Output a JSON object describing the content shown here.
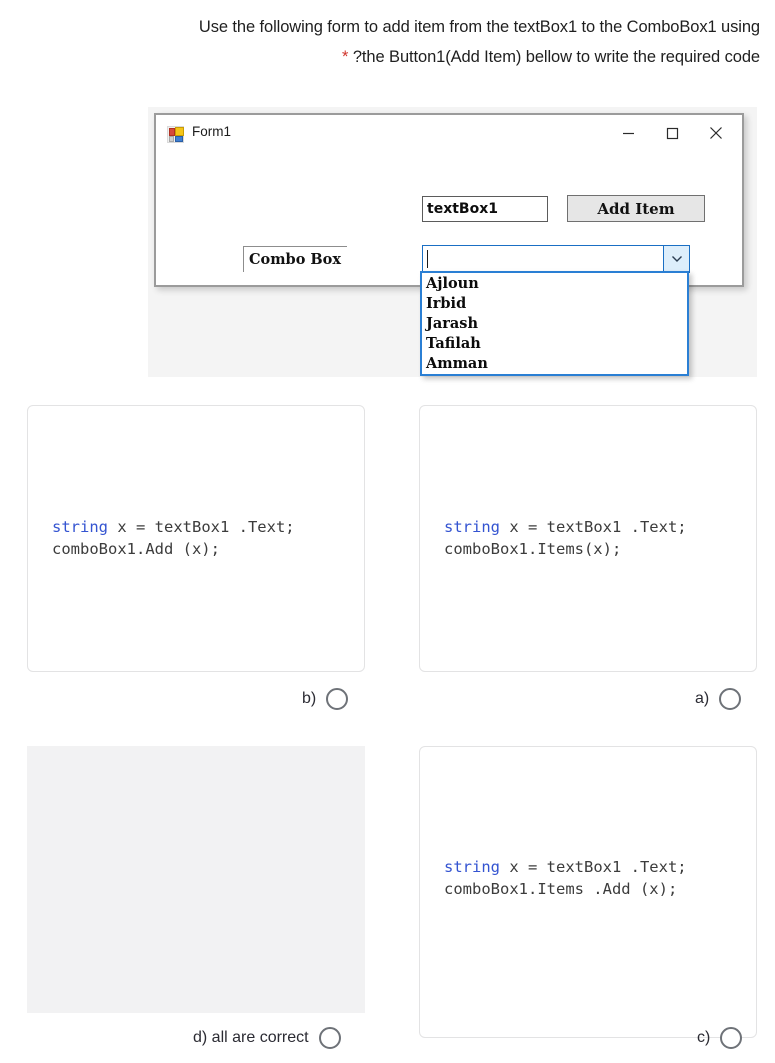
{
  "prompt": {
    "line1": "Use the following form to add item from the textBox1 to the ComboBox1 using",
    "star": "*",
    "line2": "?the Button1(Add Item) bellow to write the required code"
  },
  "form": {
    "title": "Form1",
    "window_buttons": [
      {
        "name": "minimize",
        "glyph": "minimize-icon"
      },
      {
        "name": "maximize",
        "glyph": "maximize-icon"
      },
      {
        "name": "close",
        "glyph": "close-icon"
      }
    ],
    "textbox1_value": "textBox1",
    "add_item_button": "Add Item",
    "combo_label": "Combo Box",
    "combobox_value": "",
    "dropdown_items": [
      "Ajloun",
      "Irbid",
      "Jarash",
      "Tafilah",
      "Amman"
    ]
  },
  "options": [
    {
      "id": "b",
      "label": "b)",
      "code_line1_kw": "string",
      "code_line1_rest": " x = textBox1 .Text;",
      "code_line2": "comboBox1.Add (x);",
      "blank": false
    },
    {
      "id": "a",
      "label": "a)",
      "code_line1_kw": "string",
      "code_line1_rest": " x = textBox1 .Text;",
      "code_line2": "comboBox1.Items(x);",
      "blank": false
    },
    {
      "id": "d",
      "label": "d) all are correct",
      "code_line1_kw": "",
      "code_line1_rest": "",
      "code_line2": "",
      "blank": true
    },
    {
      "id": "c",
      "label": "c)",
      "code_line1_kw": "string",
      "code_line1_rest": " x = textBox1 .Text;",
      "code_line2": "comboBox1.Items .Add (x);",
      "blank": false
    }
  ],
  "colors": {
    "keyword": "#3454d1",
    "code_text": "#3c3c3c",
    "asterisk": "#d0342c",
    "combo_accent": "#1a6fc4"
  }
}
